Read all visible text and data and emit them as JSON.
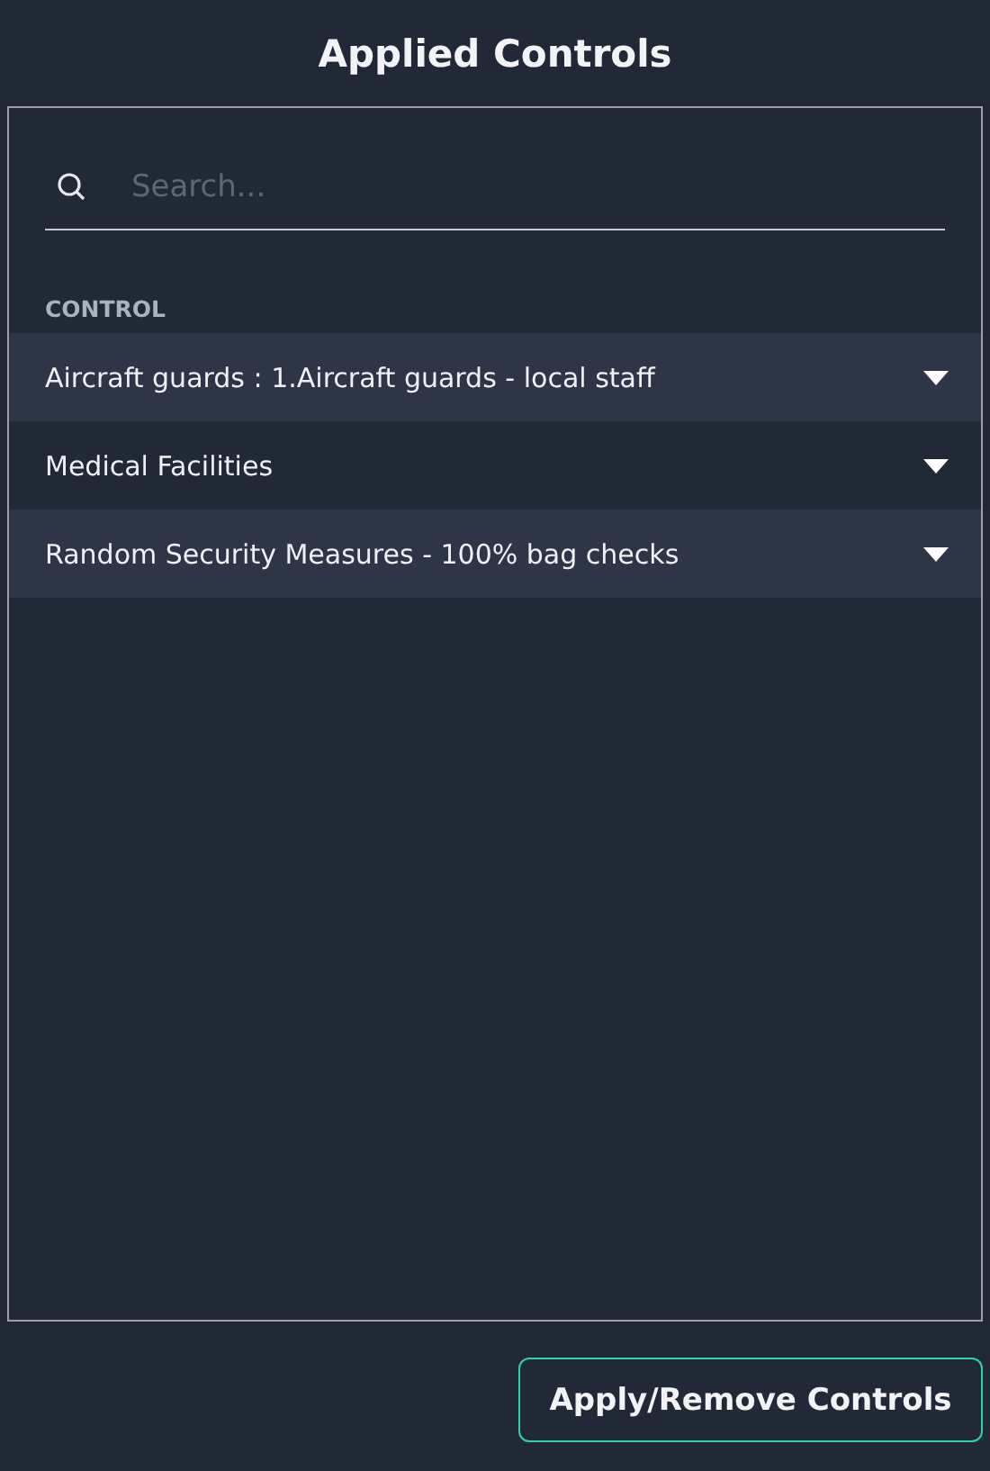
{
  "title": "Applied Controls",
  "search": {
    "placeholder": "Search..."
  },
  "table": {
    "column": "CONTROL",
    "rows": [
      {
        "label": "Aircraft guards : 1.Aircraft guards - local staff",
        "expanded": false
      },
      {
        "label": "Medical Facilities",
        "expanded": false
      },
      {
        "label": "Random Security Measures - 100% bag checks",
        "expanded": false
      }
    ]
  },
  "button": "Apply/Remove Controls"
}
